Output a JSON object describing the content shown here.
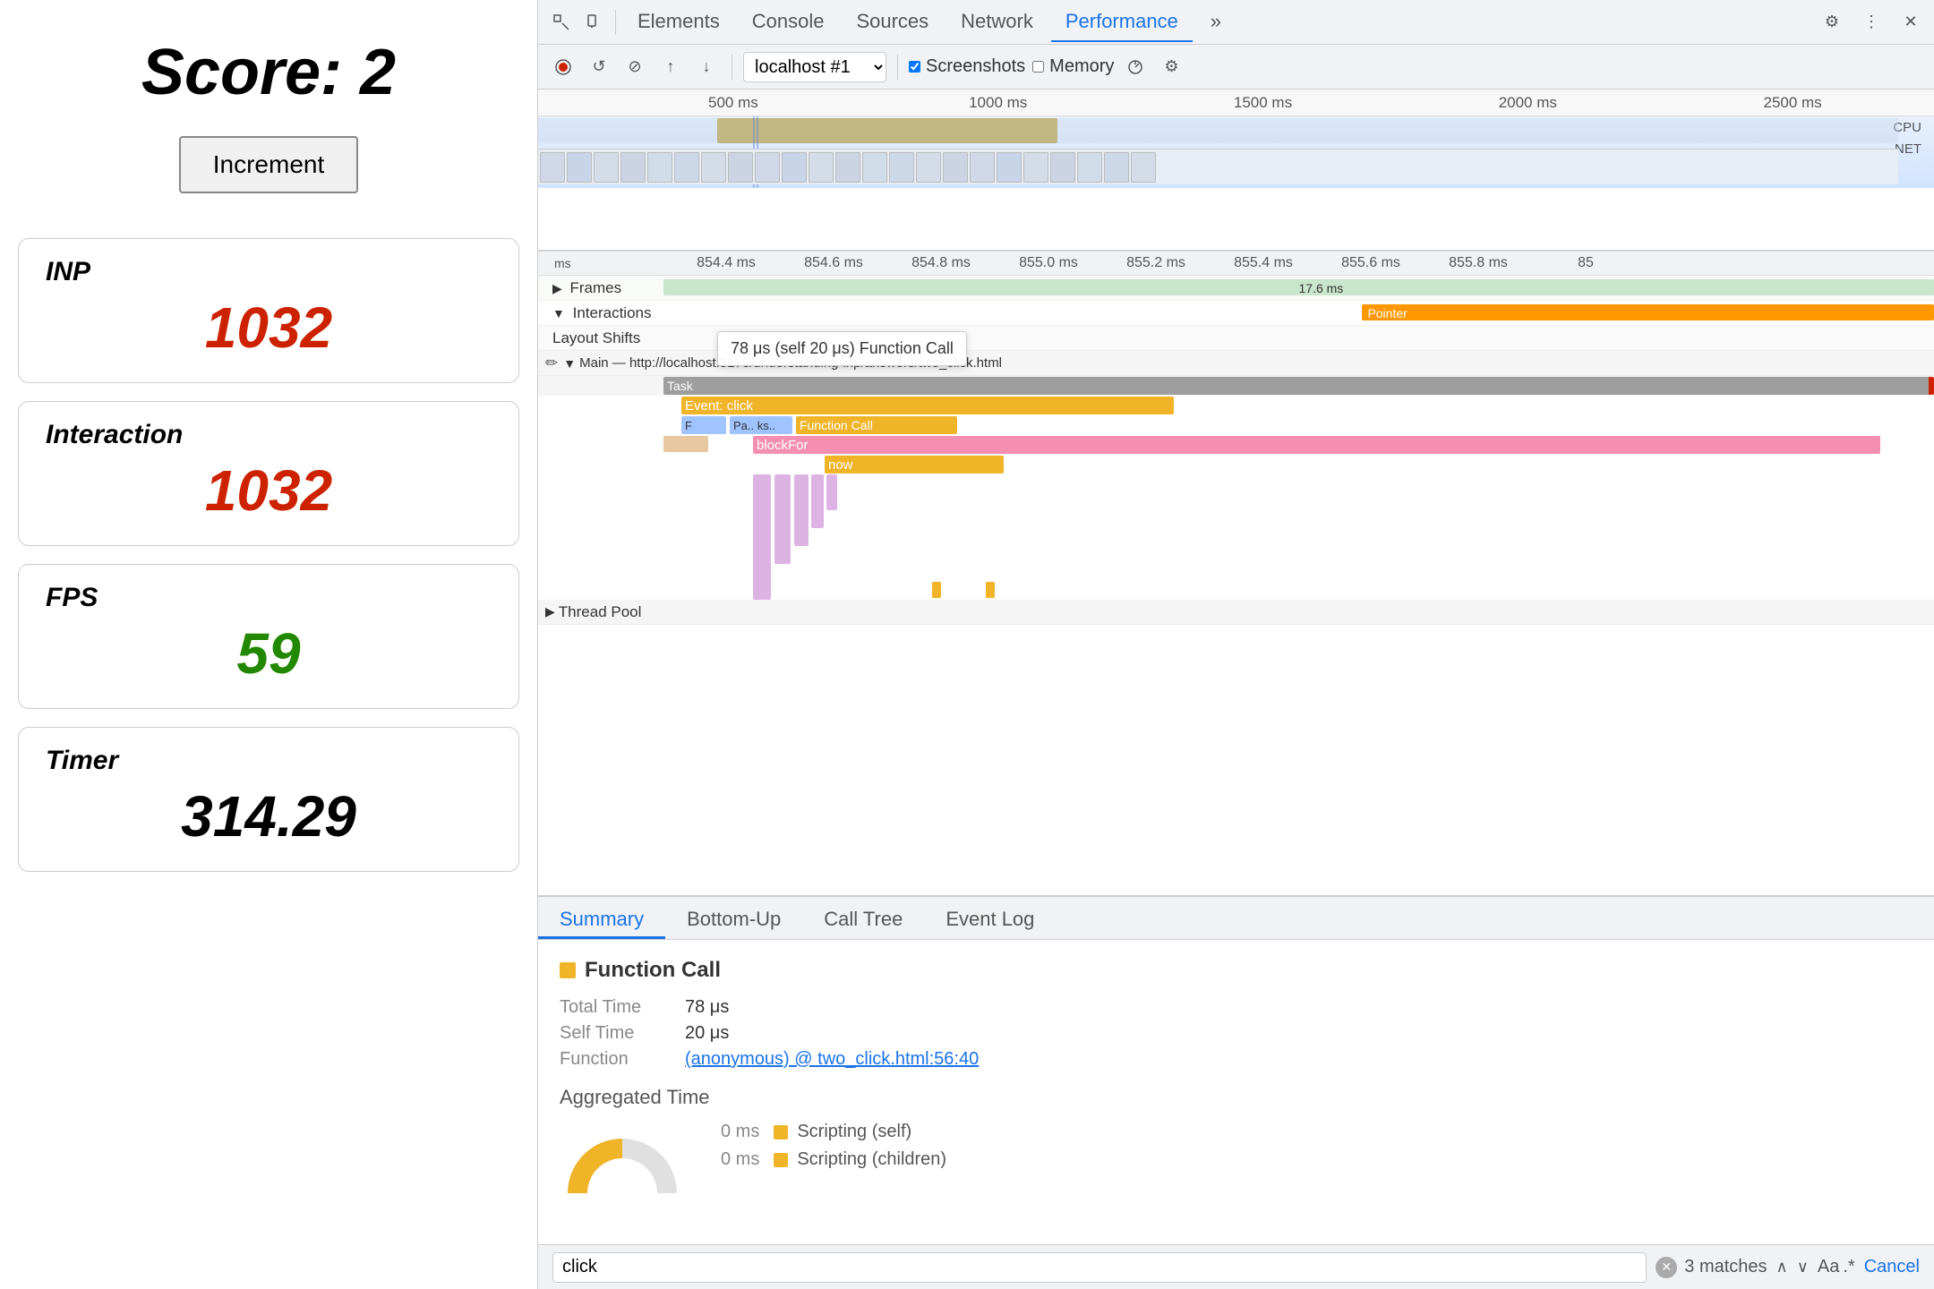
{
  "left": {
    "score_label": "Score: 2",
    "increment_btn": "Increment",
    "metrics": [
      {
        "id": "inp",
        "label": "INP",
        "value": "1032",
        "color": "red"
      },
      {
        "id": "interaction",
        "label": "Interaction",
        "value": "1032",
        "color": "red"
      },
      {
        "id": "fps",
        "label": "FPS",
        "value": "59",
        "color": "green"
      },
      {
        "id": "timer",
        "label": "Timer",
        "value": "314.29",
        "color": "black"
      }
    ]
  },
  "devtools": {
    "tabs": [
      "Elements",
      "Console",
      "Sources",
      "Network",
      "Performance"
    ],
    "active_tab": "Performance",
    "toolbar": {
      "source_label": "localhost #1",
      "screenshots_label": "Screenshots",
      "memory_label": "Memory"
    },
    "ruler_marks": [
      "500 ms",
      "1000 ms",
      "1500 ms",
      "2000 ms",
      "2500 ms"
    ],
    "bottom_ruler_marks": [
      "ms",
      "854.4 ms",
      "854.6 ms",
      "854.8 ms",
      "855.0 ms",
      "855.2 ms",
      "855.4 ms",
      "855.6 ms",
      "855.8 ms",
      "85"
    ],
    "tracks": {
      "frames_label": "Frames",
      "frames_duration": "17.6 ms",
      "interactions_label": "Interactions",
      "pointer_label": "Pointer",
      "layout_shifts_label": "Layout Shifts"
    },
    "main_thread": {
      "label": "Main — http://localhost:5173/understanding-inp/answers/two_click.html",
      "task_label": "Task",
      "event_label": "Event: click",
      "tooltip": "78 μs (self 20 μs)  Function Call",
      "function_call_label": "Function Call",
      "blockfor_label": "blockFor",
      "now_label": "now"
    },
    "thread_pool_label": "Thread Pool",
    "bottom_tabs": [
      "Summary",
      "Bottom-Up",
      "Call Tree",
      "Event Log"
    ],
    "active_bottom_tab": "Summary",
    "summary": {
      "title": "Function Call",
      "total_time_label": "Total Time",
      "total_time_val": "78 μs",
      "self_time_label": "Self Time",
      "self_time_val": "20 μs",
      "function_label": "Function",
      "function_val": "(anonymous) @ two_click.html:56:40",
      "aggregated_title": "Aggregated Time",
      "legend": [
        {
          "color": "#f0b429",
          "val": "0 ms",
          "label": "Scripting (self)"
        },
        {
          "color": "#f0b429",
          "val": "0 ms",
          "label": "Scripting (children)"
        }
      ]
    },
    "search": {
      "value": "click",
      "matches": "3 matches",
      "cancel_label": "Cancel"
    }
  }
}
